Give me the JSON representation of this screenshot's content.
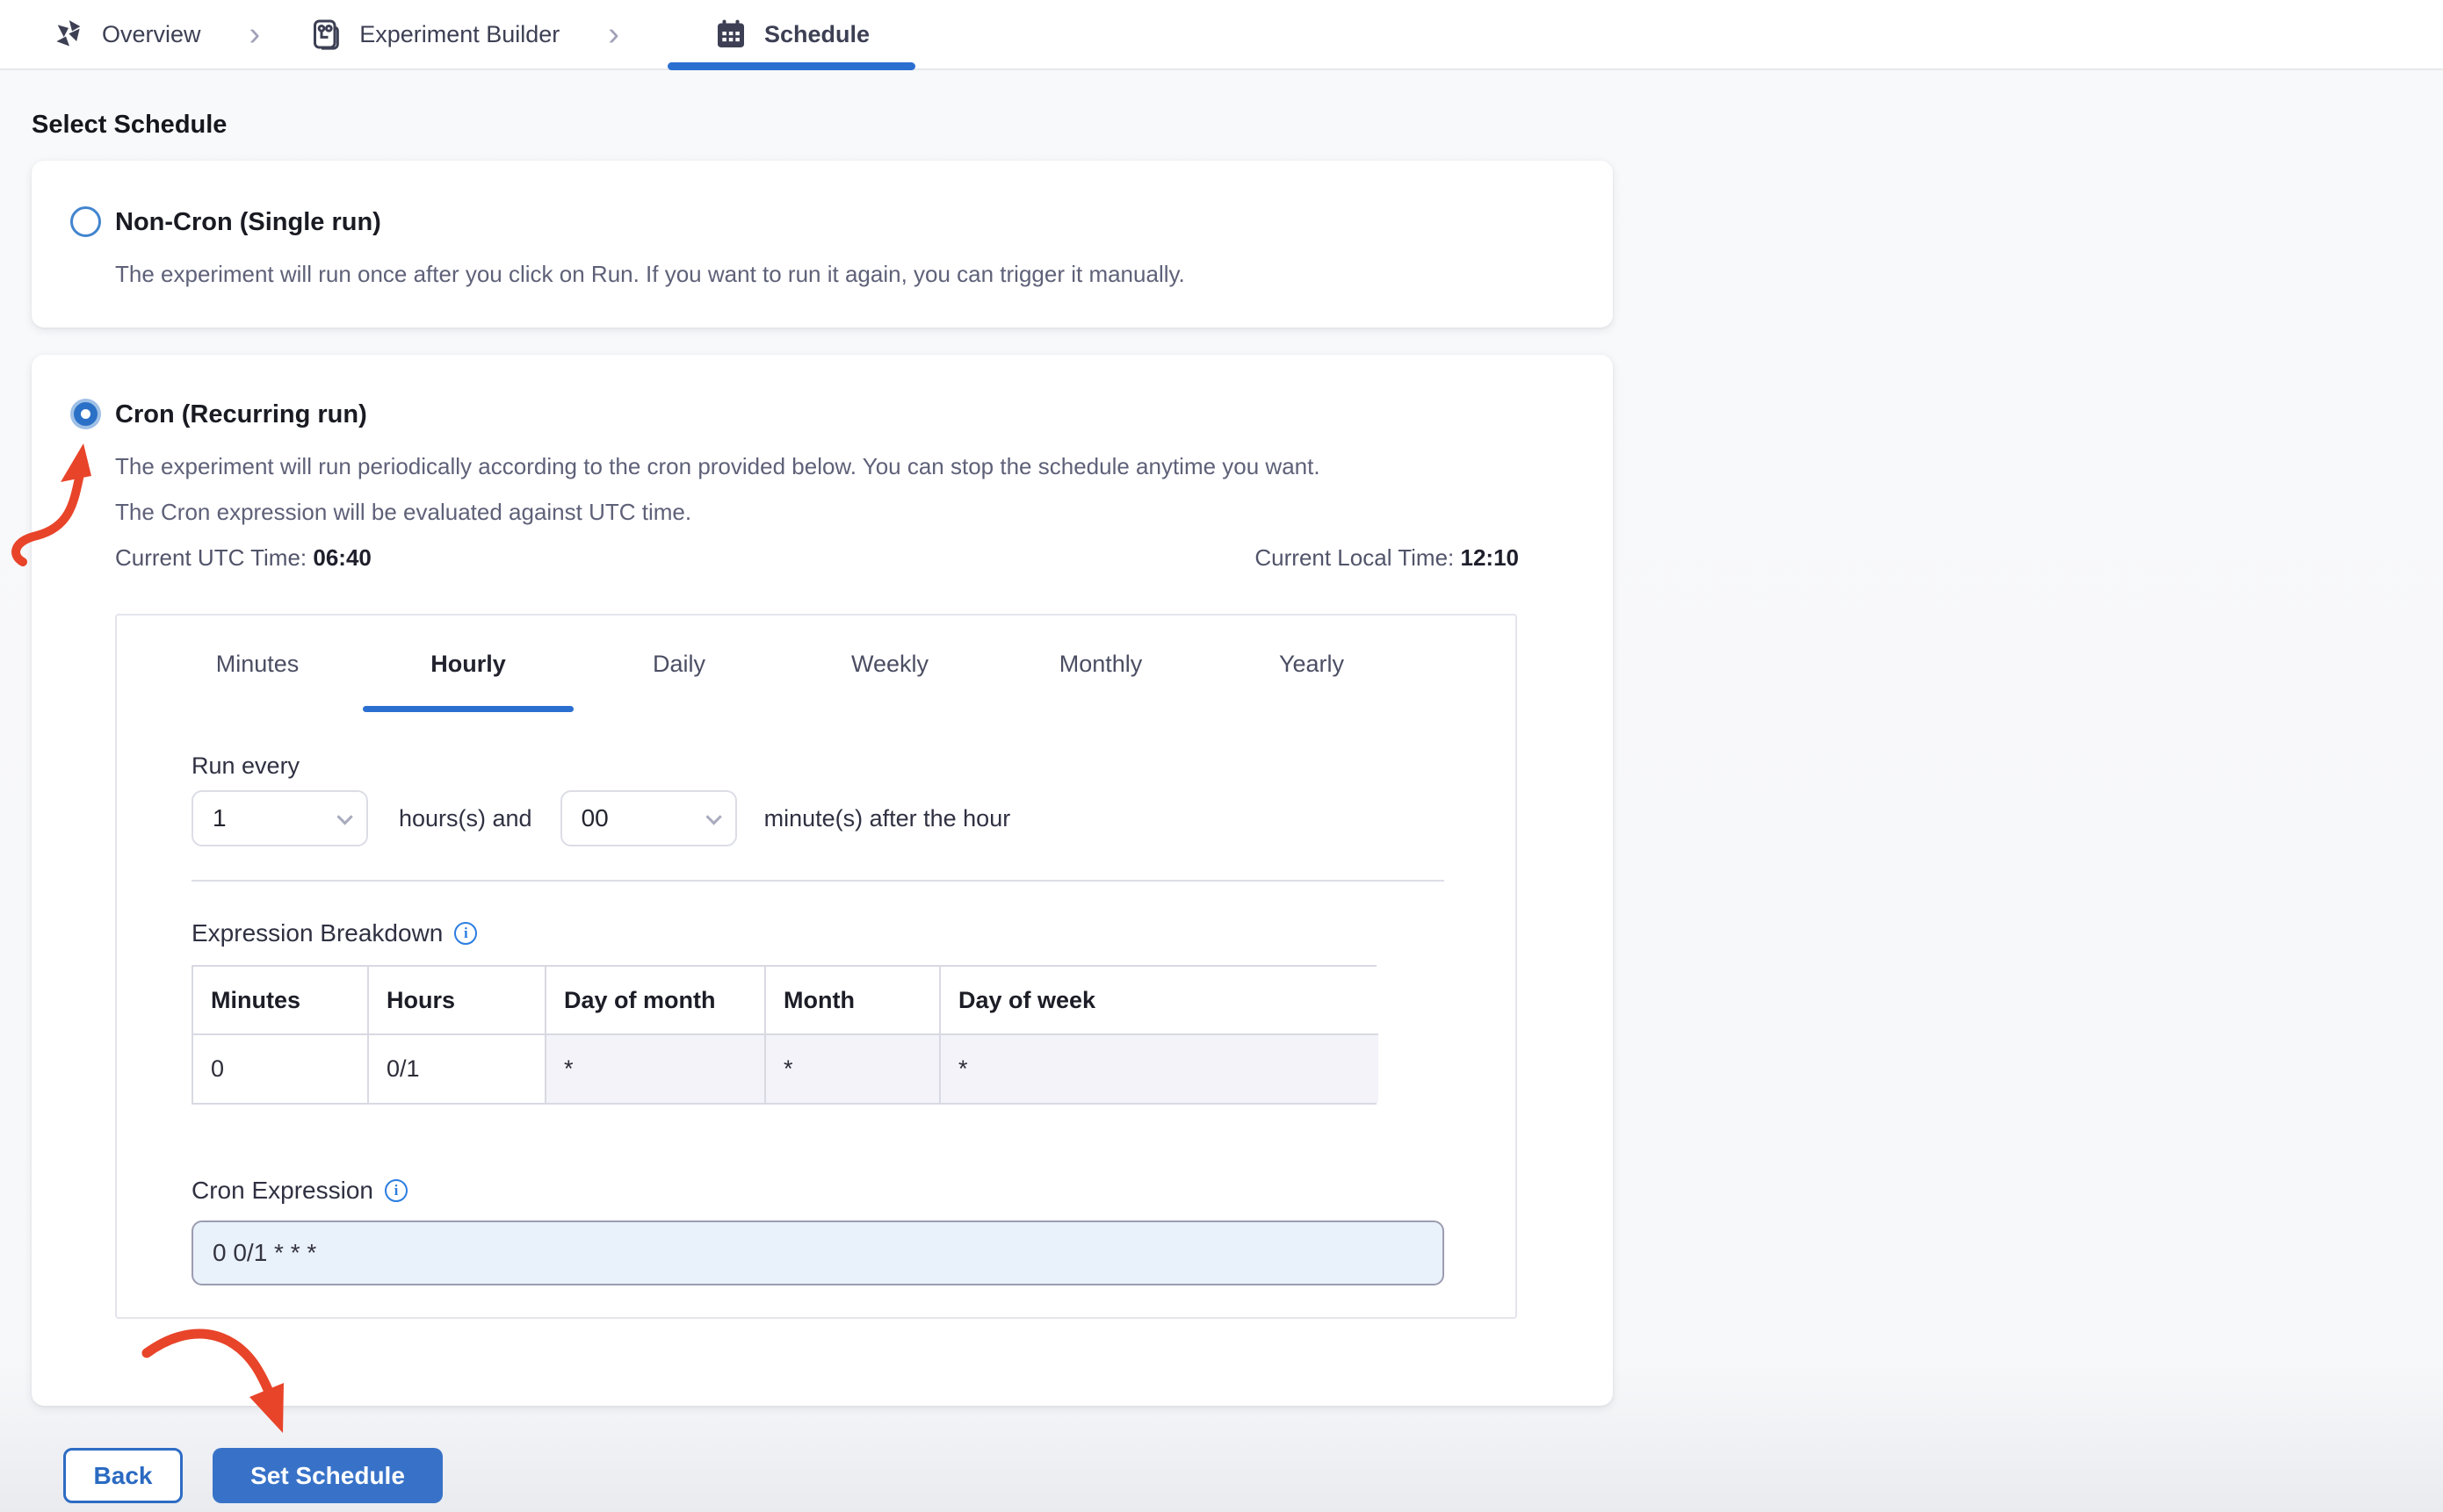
{
  "breadcrumb": {
    "items": [
      {
        "label": "Overview",
        "icon": "chaos-pinwheel-icon"
      },
      {
        "label": "Experiment Builder",
        "icon": "builder-document-icon"
      },
      {
        "label": "Schedule",
        "icon": "calendar-icon",
        "active": true
      }
    ]
  },
  "page": {
    "heading": "Select Schedule"
  },
  "options": {
    "non_cron": {
      "selected": false,
      "title": "Non-Cron (Single run)",
      "description": "The experiment will run once after you click on Run. If you want to run it again, you can trigger it manually."
    },
    "cron": {
      "selected": true,
      "title": "Cron (Recurring run)",
      "description_line1": "The experiment will run periodically according to the cron provided below. You can stop the schedule anytime you want.",
      "description_line2": "The Cron expression will be evaluated against UTC time.",
      "utc_label": "Current UTC Time:",
      "utc_value": "06:40",
      "local_label": "Current Local Time:",
      "local_value": "12:10"
    }
  },
  "scheduler": {
    "tabs": [
      {
        "label": "Minutes"
      },
      {
        "label": "Hourly",
        "active": true
      },
      {
        "label": "Daily"
      },
      {
        "label": "Weekly"
      },
      {
        "label": "Monthly"
      },
      {
        "label": "Yearly"
      }
    ],
    "run_every": {
      "label": "Run every",
      "hours_value": "1",
      "hours_suffix": "hours(s) and",
      "minutes_value": "00",
      "minutes_suffix": "minute(s) after the hour"
    },
    "expression_breakdown": {
      "label": "Expression Breakdown",
      "headers": [
        "Minutes",
        "Hours",
        "Day of month",
        "Month",
        "Day of week"
      ],
      "values": [
        "0",
        "0/1",
        "*",
        "*",
        "*"
      ]
    },
    "cron_expression": {
      "label": "Cron Expression",
      "value": "0 0/1 * * *"
    }
  },
  "footer": {
    "back_label": "Back",
    "set_schedule_label": "Set Schedule"
  },
  "colors": {
    "accent": "#3872c8",
    "tab_underline": "#2b6fd0",
    "annotation_arrow": "#E8442A"
  }
}
